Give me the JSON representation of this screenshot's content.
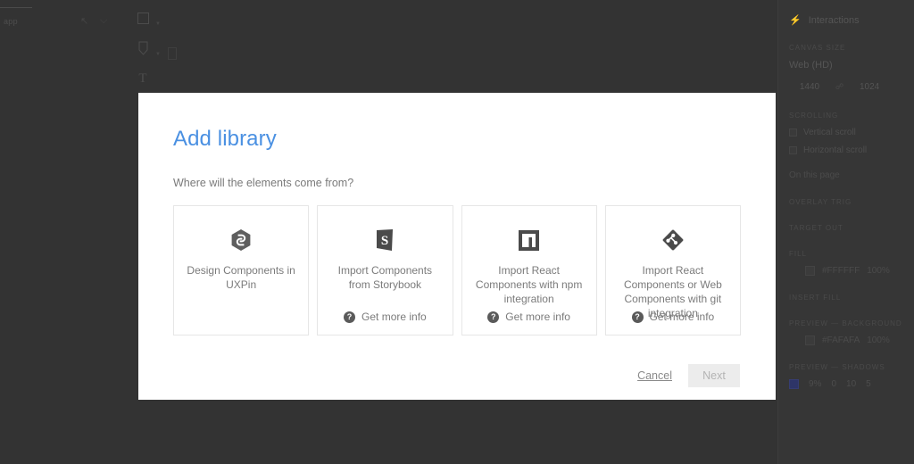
{
  "app": {
    "top_left_label": "app",
    "tool_icons": [
      "rectangle-tool",
      "pen-tool",
      "text-tool"
    ]
  },
  "inspector": {
    "interactions_label": "Interactions",
    "canvas_size_label": "CANVAS SIZE",
    "canvas_size_value": "Web (HD)",
    "canvas_width": "1440",
    "canvas_height": "1024",
    "scrolling_label": "SCROLLING",
    "vertical_scroll": "Vertical scroll",
    "horizontal_scroll": "Horizontal scroll",
    "on_this_page_label": "On this page",
    "overlay_label": "OVERLAY TRIG",
    "target_label": "TARGET  OUT",
    "fill_label": "FILL",
    "fill_value": "#FFFFFF",
    "fill_opacity": "100%",
    "insert_fill_label": "INSERT FILL",
    "preview_background_label": "PREVIEW — BACKGROUND",
    "preview_background_value": "#FAFAFA",
    "preview_background_opacity": "100%",
    "preview_shadows_label": "PREVIEW — SHADOWS",
    "shadow_opacity": "9%",
    "shadow_x": "0",
    "shadow_y": "10",
    "shadow_blur": "5"
  },
  "modal": {
    "title": "Add library",
    "subtitle": "Where will the elements come from?",
    "cards": [
      {
        "icon": "uxpin-logo-icon",
        "label": "Design Components in UXPin",
        "info_label": "",
        "has_info": false
      },
      {
        "icon": "storybook-logo-icon",
        "label": "Import Components from Storybook",
        "info_label": "Get more info",
        "has_info": true
      },
      {
        "icon": "npm-logo-icon",
        "label": "Import React Components with npm integration",
        "info_label": "Get more info",
        "has_info": true
      },
      {
        "icon": "git-logo-icon",
        "label": "Import React Components or Web Components with git integration",
        "info_label": "Get more info",
        "has_info": true
      }
    ],
    "cancel_label": "Cancel",
    "next_label": "Next"
  },
  "colors": {
    "accent": "#4a90e2",
    "modal_bg": "#ffffff",
    "backdrop": "#333333",
    "card_border": "#e6e6e6",
    "muted_text": "#7b7b7b"
  }
}
